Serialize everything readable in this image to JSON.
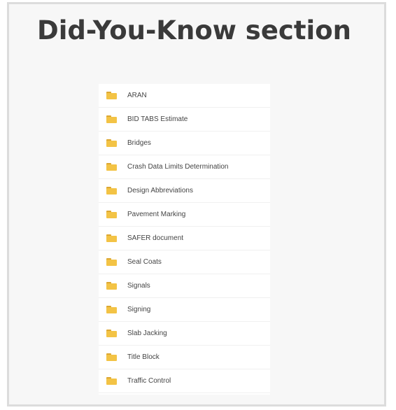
{
  "header": {
    "title": "Did-You-Know section"
  },
  "folder_list": {
    "icon": "folder-icon",
    "icon_color": "#f3c345",
    "items": [
      {
        "label": "ARAN"
      },
      {
        "label": "BID TABS Estimate"
      },
      {
        "label": "Bridges"
      },
      {
        "label": "Crash Data Limits Determination"
      },
      {
        "label": "Design Abbreviations"
      },
      {
        "label": "Pavement Marking"
      },
      {
        "label": "SAFER document"
      },
      {
        "label": "Seal Coats"
      },
      {
        "label": "Signals"
      },
      {
        "label": "Signing"
      },
      {
        "label": "Slab Jacking"
      },
      {
        "label": "Title Block"
      },
      {
        "label": "Traffic Control"
      }
    ]
  }
}
